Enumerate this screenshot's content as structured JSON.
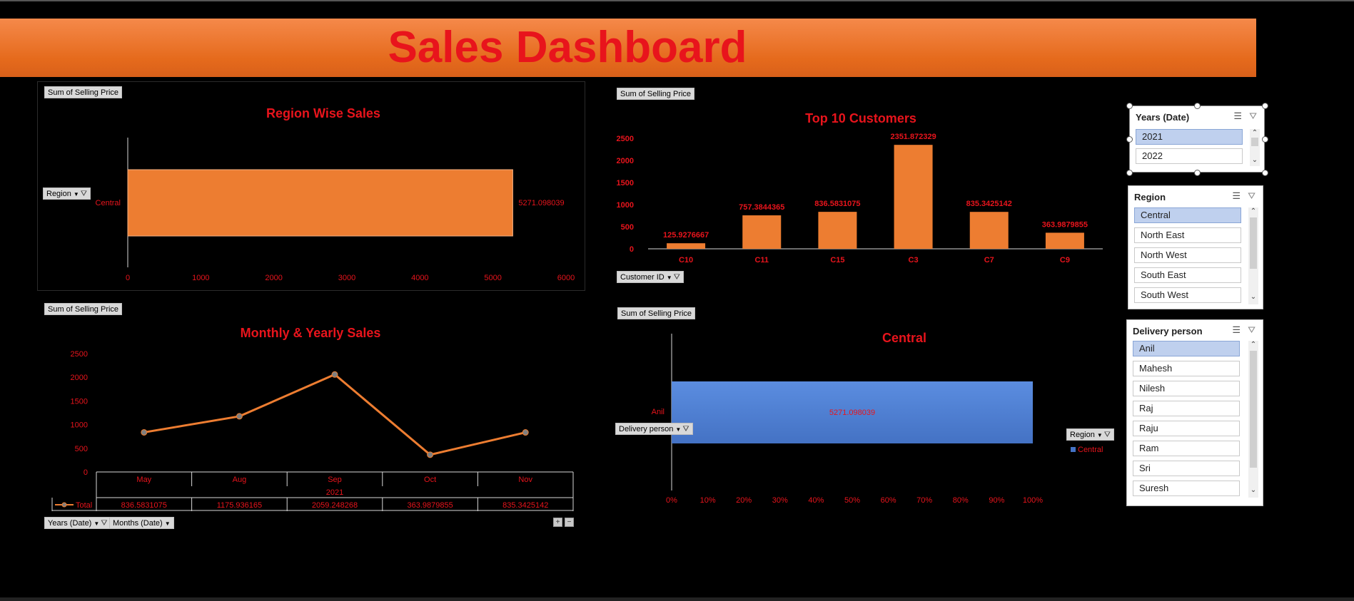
{
  "dashboard": {
    "title": "Sales Dashboard"
  },
  "region_chart": {
    "value_field": "Sum of Selling Price",
    "axis_field": "Region",
    "title": "Region Wise Sales",
    "chart_data": {
      "type": "bar",
      "orientation": "horizontal",
      "title": "Region Wise Sales",
      "categories": [
        "Central"
      ],
      "values": [
        5271.098039
      ],
      "value_labels": [
        "5271.098039"
      ],
      "xlim": [
        0,
        6000
      ],
      "x_ticks": [
        "0",
        "1000",
        "2000",
        "3000",
        "4000",
        "5000",
        "6000"
      ],
      "grid": false,
      "bar_color": "#ed7d31"
    }
  },
  "customers_chart": {
    "value_field": "Sum of Selling Price",
    "axis_field": "Customer ID",
    "title": "Top 10 Customers",
    "chart_data": {
      "type": "bar",
      "title": "Top 10 Customers",
      "categories": [
        "C10",
        "C11",
        "C15",
        "C3",
        "C7",
        "C9"
      ],
      "values": [
        125.9276667,
        757.3844365,
        836.5831075,
        2351.872329,
        835.3425142,
        363.9879855
      ],
      "value_labels": [
        "125.9276667",
        "757.3844365",
        "836.5831075",
        "2351.872329",
        "835.3425142",
        "363.9879855"
      ],
      "ylim": [
        0,
        2500
      ],
      "y_ticks": [
        "0",
        "500",
        "1000",
        "1500",
        "2000",
        "2500"
      ],
      "grid": false,
      "bar_color": "#ed7d31"
    }
  },
  "monthly_chart": {
    "value_field": "Sum of Selling Price",
    "title": "Monthly & Yearly Sales",
    "filter_years": "Years (Date)",
    "filter_months": "Months (Date)",
    "plus": "+",
    "minus": "−",
    "chart_data": {
      "type": "line",
      "title": "Monthly & Yearly Sales",
      "categories": [
        "May",
        "Aug",
        "Sep",
        "Oct",
        "Nov"
      ],
      "year_label": "2021",
      "series": [
        {
          "name": "Total",
          "values": [
            836.5831075,
            1175.936165,
            2059.248268,
            363.9879855,
            835.3425142
          ],
          "value_labels": [
            "836.5831075",
            "1175.936165",
            "2059.248268",
            "363.9879855",
            "835.3425142"
          ]
        }
      ],
      "ylim": [
        0,
        2500
      ],
      "y_ticks": [
        "0",
        "500",
        "1000",
        "1500",
        "2000",
        "2500"
      ],
      "grid": false,
      "line_color": "#ed7d31",
      "data_table": true
    }
  },
  "central_chart": {
    "value_field": "Sum of Selling Price",
    "axis_field": "Delivery person",
    "legend_field": "Region",
    "title": "Central",
    "chart_data": {
      "type": "bar",
      "orientation": "horizontal",
      "stacking": "100%",
      "title": "Central",
      "categories": [
        "Anil"
      ],
      "series": [
        {
          "name": "Central",
          "values": [
            5271.098039
          ],
          "share": 1.0,
          "value_label": "5271.098039"
        }
      ],
      "xlim": [
        0,
        100
      ],
      "x_ticks": [
        "0%",
        "10%",
        "20%",
        "30%",
        "40%",
        "50%",
        "60%",
        "70%",
        "80%",
        "90%",
        "100%"
      ],
      "legend": "right",
      "grid": false,
      "bar_color": "#4472c4"
    }
  },
  "slicers": {
    "years": {
      "title": "Years (Date)",
      "items": [
        {
          "label": "2021",
          "selected": true
        },
        {
          "label": "2022",
          "selected": false
        }
      ]
    },
    "region": {
      "title": "Region",
      "items": [
        {
          "label": "Central",
          "selected": true
        },
        {
          "label": "North East",
          "selected": false
        },
        {
          "label": "North West",
          "selected": false
        },
        {
          "label": "South East",
          "selected": false
        },
        {
          "label": "South West",
          "selected": false
        }
      ]
    },
    "delivery": {
      "title": "Delivery person",
      "items": [
        {
          "label": "Anil",
          "selected": true
        },
        {
          "label": "Mahesh",
          "selected": false
        },
        {
          "label": "Nilesh",
          "selected": false
        },
        {
          "label": "Raj",
          "selected": false
        },
        {
          "label": "Raju",
          "selected": false
        },
        {
          "label": "Ram",
          "selected": false
        },
        {
          "label": "Sri",
          "selected": false
        },
        {
          "label": "Suresh",
          "selected": false
        }
      ]
    }
  },
  "icons": {
    "multiselect": "multi-select-icon",
    "clear_filter": "clear-filter-icon",
    "dropdown": "dropdown-icon",
    "filter": "filter-icon"
  },
  "colors": {
    "accent_red": "#e8141c",
    "bar_orange": "#ed7d31",
    "bar_blue": "#4472c4",
    "banner_orange": "#ee7a35",
    "background": "#000000"
  }
}
